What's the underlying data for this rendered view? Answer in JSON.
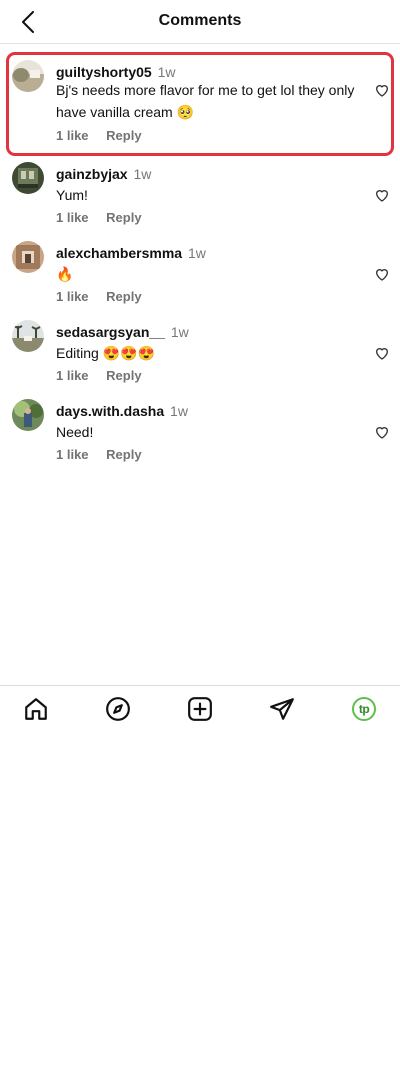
{
  "header": {
    "title": "Comments",
    "back_icon": "chevron-left-icon"
  },
  "comments": [
    {
      "username": "guiltyshorty05",
      "time": "1w",
      "text": "Bj's needs more flavor for me to get lol they only have vanilla cream 🥺",
      "likes": "1 like",
      "reply": "Reply",
      "highlighted": true
    },
    {
      "username": "gainzbyjax",
      "time": "1w",
      "text": "Yum!",
      "likes": "1 like",
      "reply": "Reply"
    },
    {
      "username": "alexchambersmma",
      "time": "1w",
      "text": "🔥",
      "likes": "1 like",
      "reply": "Reply"
    },
    {
      "username": "sedasargsyan__",
      "time": "1w",
      "text": "Editing 😍😍😍",
      "likes": "1 like",
      "reply": "Reply"
    },
    {
      "username": "days.with.dasha",
      "time": "1w",
      "text": "Need!",
      "likes": "1 like",
      "reply": "Reply"
    }
  ],
  "bottom_nav": {
    "items": [
      "home-icon",
      "explore-compass-icon",
      "create-post-icon",
      "direct-message-icon",
      "profile-avatar-icon"
    ],
    "profile_initials": "tp"
  },
  "colors": {
    "highlight": "#e0343f",
    "profile_ring": "#5cc04b"
  }
}
